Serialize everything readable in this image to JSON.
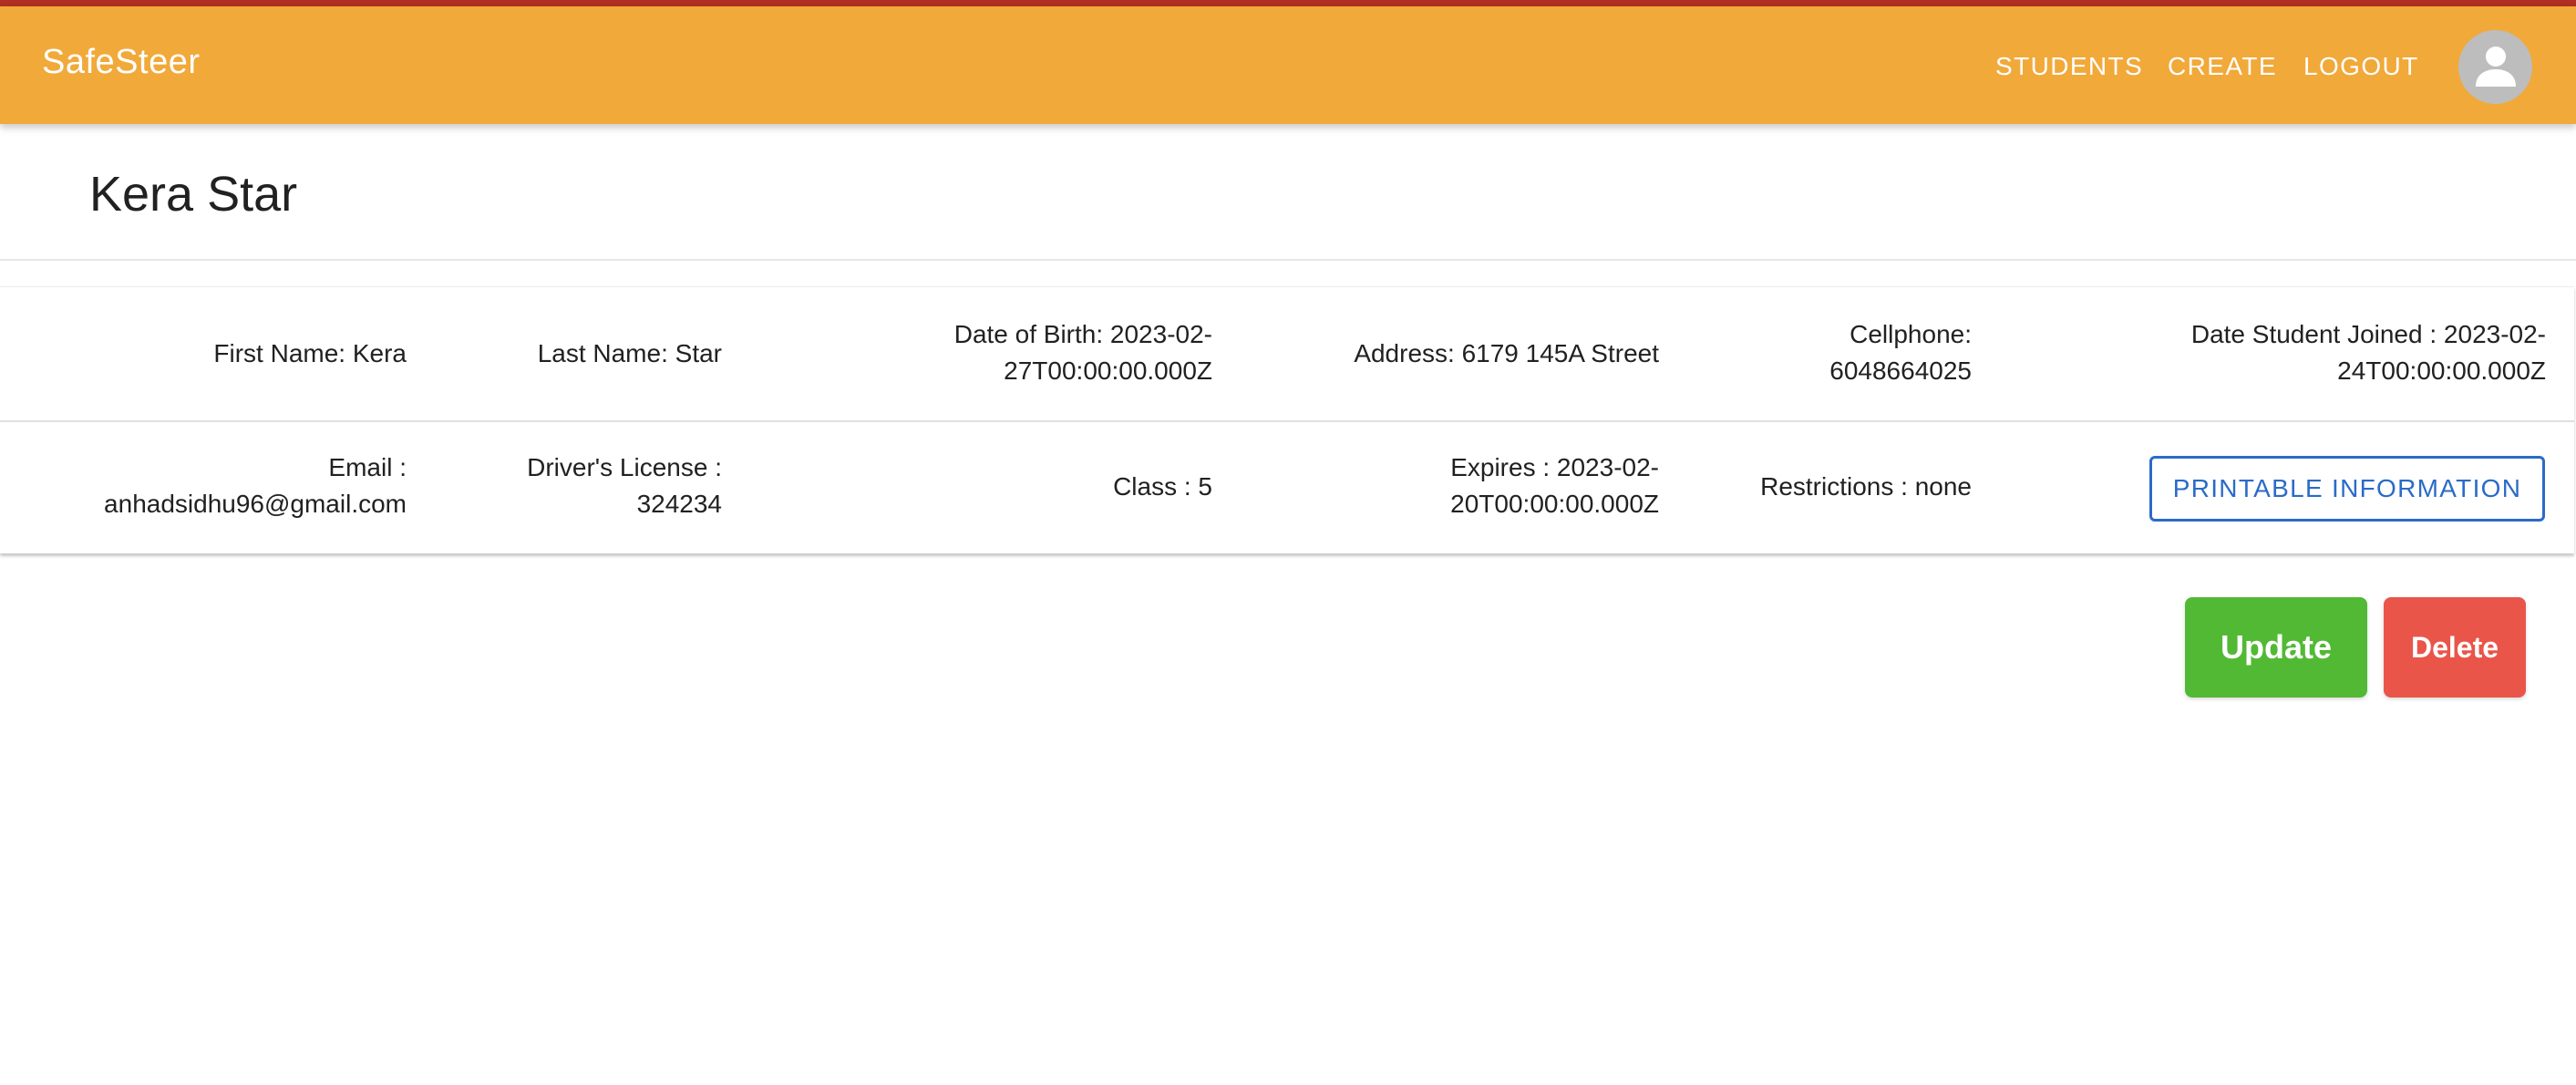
{
  "app": {
    "brand": "SafeSteer",
    "nav": [
      "STUDENTS",
      "CREATE",
      "LOGOUT"
    ],
    "avatar_icon": "person-icon"
  },
  "student": {
    "title": "Kera Star",
    "row1": {
      "first_name": "First Name: Kera",
      "last_name": "Last Name: Star",
      "dob": "Date of Birth: 2023-02-\n27T00:00:00.000Z",
      "address": "Address: 6179 145A Street",
      "cellphone": "Cellphone:\n6048664025",
      "joined": "Date Student Joined : 2023-02-\n24T00:00:00.000Z"
    },
    "row2": {
      "email": "Email :\nanhadsidhu96@gmail.com",
      "license": "Driver's License :\n324234",
      "class": "Class : 5",
      "expires": "Expires : 2023-02-\n20T00:00:00.000Z",
      "restrictions": "Restrictions : none",
      "print_button": "PRINTABLE INFORMATION"
    }
  },
  "actions": {
    "update": "Update",
    "delete": "Delete"
  },
  "colors": {
    "appbar": "#f1a93a",
    "topline": "#b12e22",
    "link_blue": "#2a6bc8",
    "update_green": "#52b934",
    "delete_red": "#ea5549"
  }
}
